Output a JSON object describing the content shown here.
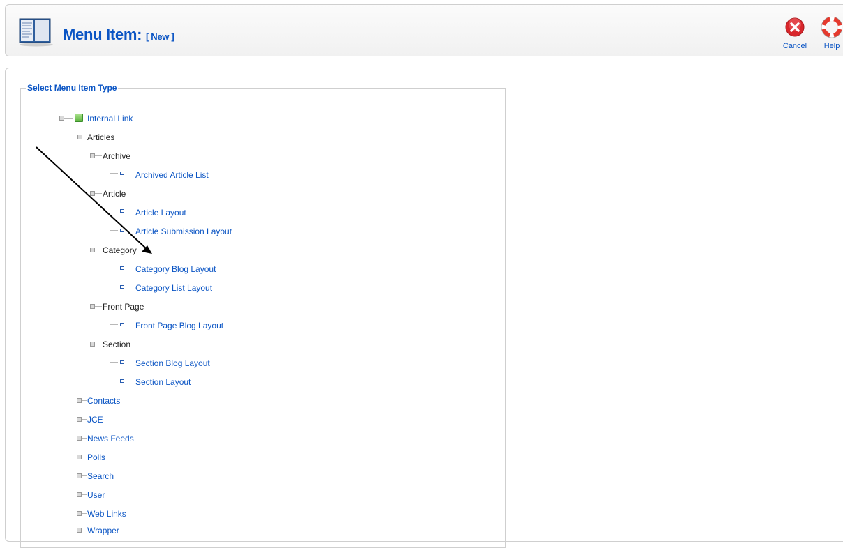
{
  "header": {
    "title": "Menu Item:",
    "subtitle": "[ New ]",
    "toolbar": {
      "cancel_label": "Cancel",
      "help_label": "Help"
    }
  },
  "fieldset": {
    "legend": "Select Menu Item Type"
  },
  "tree": {
    "root": "Internal Link",
    "articles": "Articles",
    "archive": "Archive",
    "archived_article_list": "Archived Article List",
    "article": "Article",
    "article_layout": "Article Layout",
    "article_submission_layout": "Article Submission Layout",
    "category": "Category",
    "category_blog_layout": "Category Blog Layout",
    "category_list_layout": "Category List Layout",
    "front_page": "Front Page",
    "front_page_blog_layout": "Front Page Blog Layout",
    "section": "Section",
    "section_blog_layout": "Section Blog Layout",
    "section_layout": "Section Layout",
    "contacts": "Contacts",
    "jce": "JCE",
    "news_feeds": "News Feeds",
    "polls": "Polls",
    "search": "Search",
    "user": "User",
    "web_links": "Web Links",
    "wrapper": "Wrapper"
  },
  "colors": {
    "link": "#0b55c4",
    "cancel_icon": "#d8262b",
    "help_icon": "#e53a2e"
  }
}
